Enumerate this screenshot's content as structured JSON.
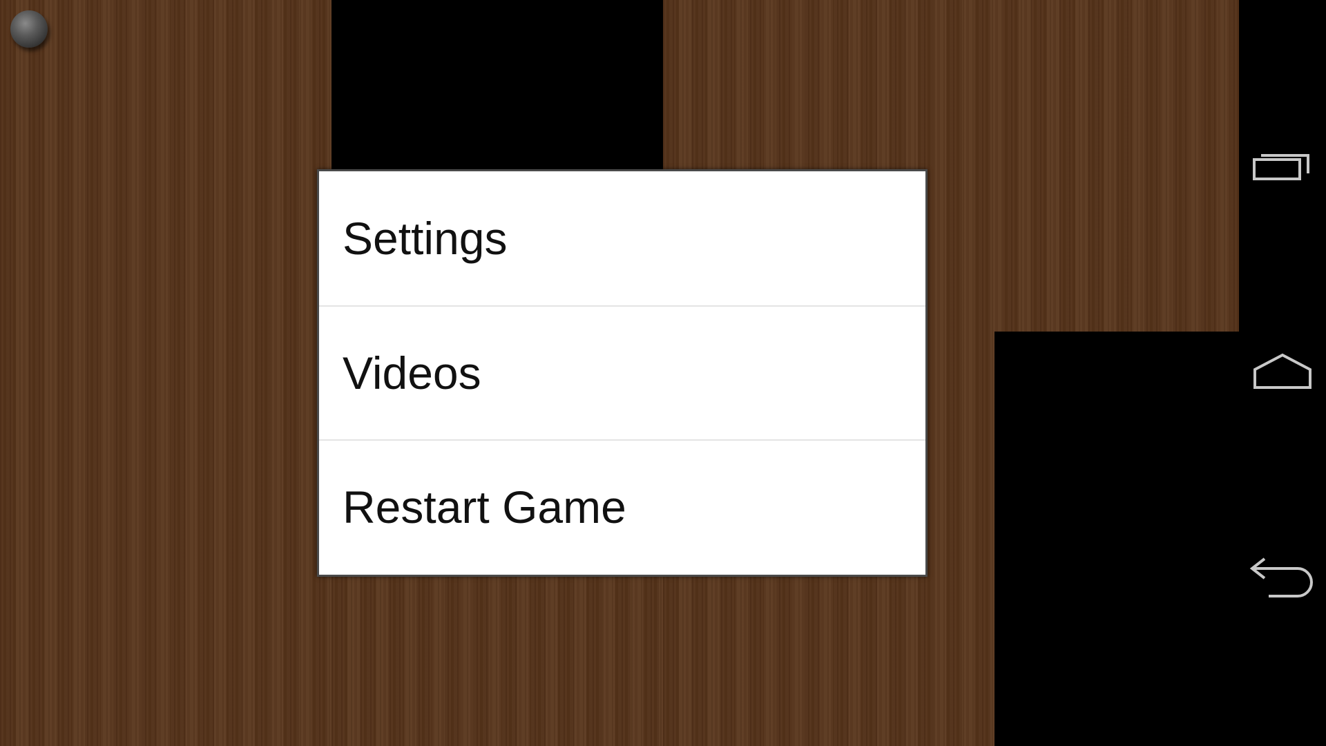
{
  "menu": {
    "items": [
      {
        "label": "Settings"
      },
      {
        "label": "Videos"
      },
      {
        "label": "Restart Game"
      }
    ]
  },
  "game": {
    "marble_color": "#555555",
    "wood_color": "#57341a"
  },
  "nav_bar": {
    "buttons": [
      {
        "icon": "recent-apps-icon"
      },
      {
        "icon": "home-icon"
      },
      {
        "icon": "back-icon"
      }
    ],
    "icon_color": "#c8c8c8"
  }
}
